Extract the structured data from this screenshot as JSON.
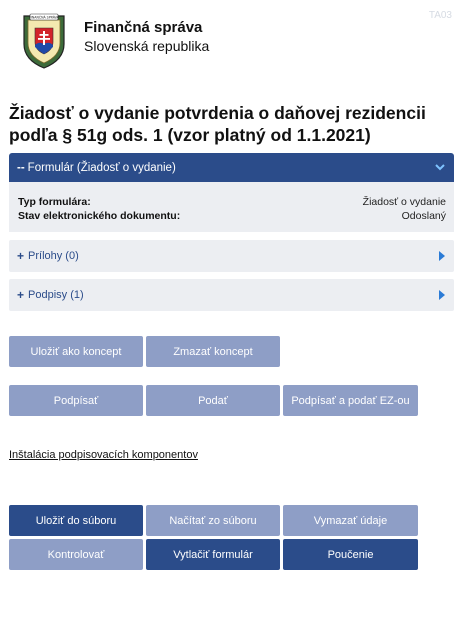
{
  "corner_code": "TA03",
  "header": {
    "title": "Finančná správa",
    "subtitle": "Slovenská republika",
    "logo_icon": "financna-sprava-crest",
    "logo_text": "FINANČNÁ SPRÁVA SLOVENSKEJ REPUBLIKY"
  },
  "page_title": "Žiadosť o vydanie potvrdenia o daňovej rezidencii podľa § 51g ods. 1 (vzor platný od 1.1.2021)",
  "form_section": {
    "lead": "--",
    "label": "Formulár (Žiadosť o vydanie)",
    "chevron_icon": "chevron-down-icon",
    "rows": [
      {
        "key": "Typ formulára:",
        "value": "Žiadosť o vydanie"
      },
      {
        "key": "Stav elektronického dokumentu:",
        "value": "Odoslaný"
      }
    ]
  },
  "attachments": {
    "plus": "+",
    "label": "Prílohy (0)"
  },
  "signatures": {
    "plus": "+",
    "label": "Podpisy (1)"
  },
  "buttons_row1": {
    "save_draft": "Uložiť ako koncept",
    "delete_draft": "Zmazať koncept"
  },
  "buttons_row2": {
    "sign": "Podpísať",
    "submit": "Podať",
    "sign_submit": "Podpísať a podať EZ-ou"
  },
  "install_link": "Inštalácia podpisovacích komponentov",
  "buttons_row3": {
    "save_file": "Uložiť do súboru",
    "load_file": "Načítať zo súboru",
    "clear_data": "Vymazať údaje"
  },
  "buttons_row4": {
    "check": "Kontrolovať",
    "print": "Vytlačiť formulár",
    "instructions": "Poučenie"
  },
  "colors": {
    "primary": "#2b4c8a",
    "button_light": "#8e9ec6",
    "panel_bg": "#eceef2"
  }
}
